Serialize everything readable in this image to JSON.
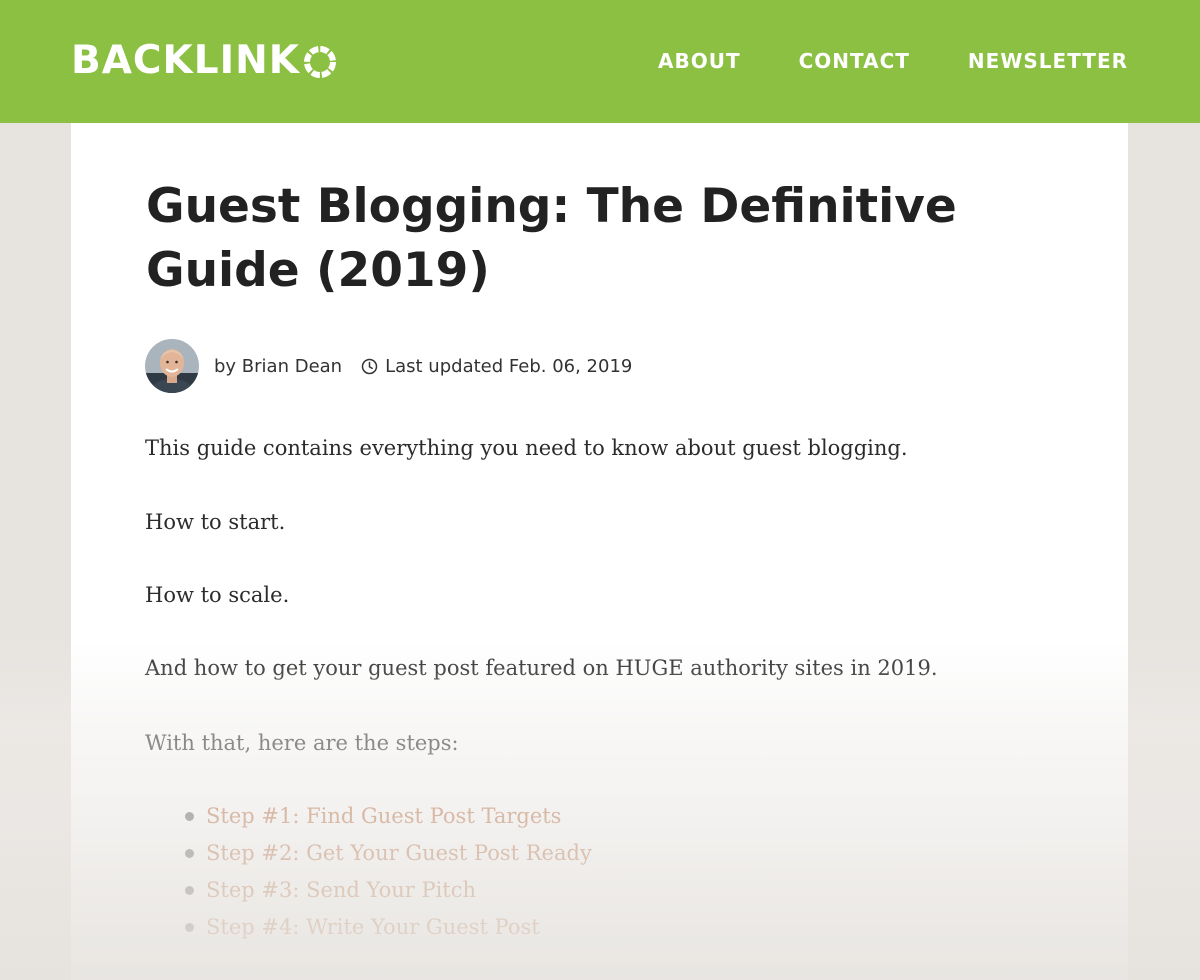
{
  "brand": {
    "logo_text": "BACKLINK",
    "header_color": "#8cc043"
  },
  "nav": {
    "items": [
      {
        "label": "ABOUT"
      },
      {
        "label": "CONTACT"
      },
      {
        "label": "NEWSLETTER"
      }
    ]
  },
  "article": {
    "title": "Guest Blogging: The Definitive Guide (2019)",
    "byline": "by Brian Dean",
    "updated": "Last updated Feb. 06, 2019",
    "paragraphs": [
      "This guide contains everything you need to know about guest blogging.",
      "How to start.",
      "How to scale.",
      "And how to get your guest post featured on HUGE authority sites in 2019.",
      "With that, here are the steps:"
    ],
    "steps": [
      {
        "label": "Step #1: Find Guest Post Targets"
      },
      {
        "label": "Step #2: Get Your Guest Post Ready"
      },
      {
        "label": "Step #3: Send Your Pitch"
      },
      {
        "label": "Step #4: Write Your Guest Post"
      }
    ],
    "link_color": "#b5683a"
  },
  "icons": {
    "logo_mark": "logo-o-circle-icon",
    "clock": "clock-icon",
    "avatar": "author-avatar"
  }
}
